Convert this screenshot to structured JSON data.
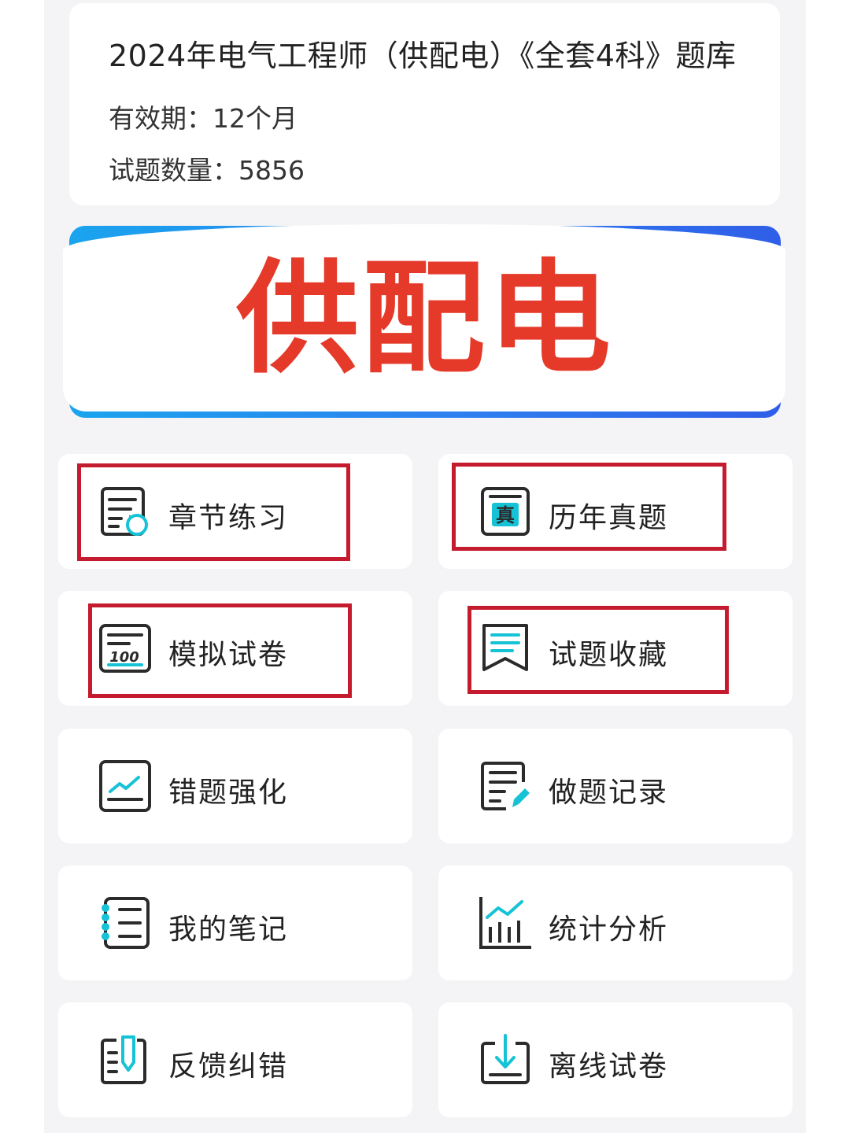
{
  "product": {
    "title": "2024年电气工程师（供配电）《全套4科》题库",
    "validity": "有效期：12个月",
    "question_count": "试题数量：5856"
  },
  "banner": {
    "text": "供配电"
  },
  "menu": [
    {
      "label": "章节练习",
      "icon": "chapter-practice-icon",
      "highlighted": true
    },
    {
      "label": "历年真题",
      "icon": "past-exams-icon",
      "highlighted": true
    },
    {
      "label": "模拟试卷",
      "icon": "mock-exam-icon",
      "highlighted": true
    },
    {
      "label": "试题收藏",
      "icon": "bookmark-icon",
      "highlighted": true
    },
    {
      "label": "错题强化",
      "icon": "mistake-review-icon",
      "highlighted": false
    },
    {
      "label": "做题记录",
      "icon": "practice-record-icon",
      "highlighted": false
    },
    {
      "label": "我的笔记",
      "icon": "notes-icon",
      "highlighted": false
    },
    {
      "label": "统计分析",
      "icon": "statistics-icon",
      "highlighted": false
    },
    {
      "label": "反馈纠错",
      "icon": "feedback-icon",
      "highlighted": false
    },
    {
      "label": "离线试卷",
      "icon": "offline-download-icon",
      "highlighted": false
    }
  ],
  "colors": {
    "highlight_border": "#c41b2e",
    "banner_text": "#e53a2a",
    "icon_accent": "#16c3d6",
    "icon_stroke": "#2b2b2b",
    "banner_gradient_start": "#1aa4ee",
    "banner_gradient_end": "#2f5ee8"
  }
}
